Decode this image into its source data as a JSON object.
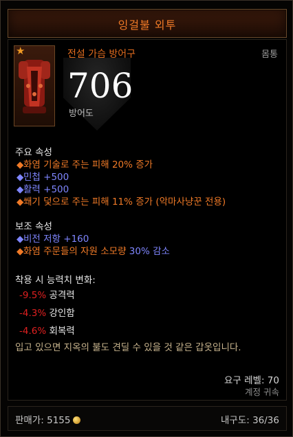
{
  "item": {
    "name": "잉걸불 외투",
    "type": "전설 가슴 방어구",
    "slot": "몸통",
    "armor": "706",
    "armor_label": "방어도"
  },
  "primary": {
    "header": "주요 속성",
    "lines": [
      {
        "text": "화염 기술로 주는 피해 20% 증가"
      },
      {
        "text": "민첩 +500"
      },
      {
        "text": "활력 +500"
      },
      {
        "text": "쐐기 덫으로 주는 피해 11% 증가 (악마사냥꾼 전용)"
      }
    ]
  },
  "secondary": {
    "header": "보조 속성",
    "line1": "비전 저항 +160",
    "line2_a": "화염 주문들의 자원 소모량 ",
    "line2_b": "30% 감소"
  },
  "equip": {
    "header": "착용 시 능력치 변화:",
    "changes": [
      {
        "delta": "-9.5%",
        "stat": "공격력"
      },
      {
        "delta": "-4.3%",
        "stat": "강인함"
      },
      {
        "delta": "-4.6%",
        "stat": "회복력"
      }
    ]
  },
  "flavor": "입고 있으면 지옥의 불도 견딜 수 있을 것 같은 갑옷입니다.",
  "requirements": {
    "level": "요구 레벨: 70",
    "bind": "계정 귀속"
  },
  "footer": {
    "sell_label": "판매가: 5155",
    "durability": "내구도: 36/36"
  },
  "colors": {
    "legendary_orange": "#f07a27",
    "affix_blue": "#7f86ff",
    "negative_red": "#e02020",
    "flavor_tan": "#c7b38d"
  }
}
